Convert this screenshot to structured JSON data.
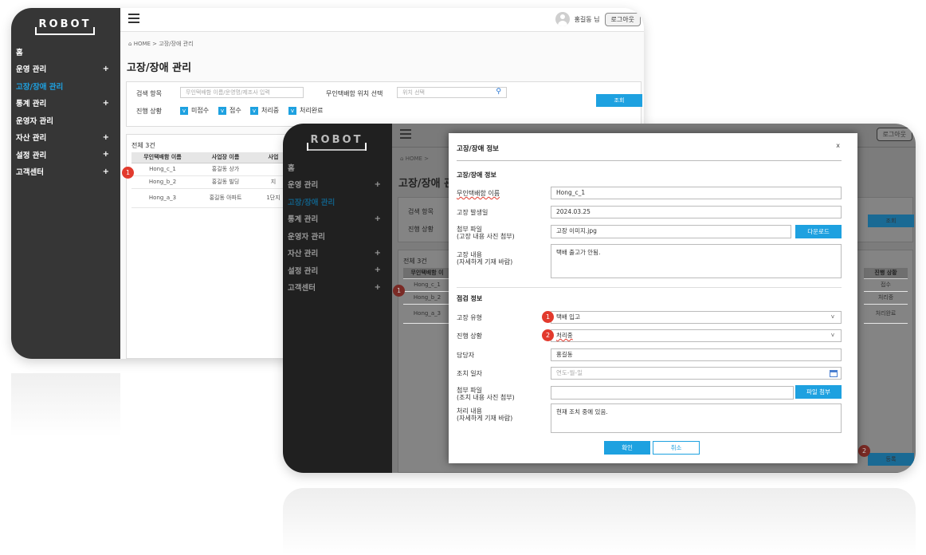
{
  "app": {
    "logo": "ROBOT",
    "user_name": "홍길동 님",
    "logout_label": "로그아웃"
  },
  "sidebar": {
    "items": [
      {
        "label": "홈",
        "plus": ""
      },
      {
        "label": "운영 관리",
        "plus": "+"
      },
      {
        "label": "고장/장애 관리",
        "plus": ""
      },
      {
        "label": "통계 관리",
        "plus": "+"
      },
      {
        "label": "운영자 관리",
        "plus": ""
      },
      {
        "label": "자산 관리",
        "plus": "+"
      },
      {
        "label": "설정 관리",
        "plus": "+"
      },
      {
        "label": "고객센터",
        "plus": "+"
      }
    ]
  },
  "breadcrumb": {
    "home": "HOME",
    "separator": ">",
    "current": "고장/장애 관리"
  },
  "page_title": "고장/장애 관리",
  "search": {
    "item_label": "검색 항목",
    "item_placeholder": "무인택배함 이름/운영명/제조사 입력",
    "location_label": "무인택배함 위치 선택",
    "location_placeholder": "위치 선택",
    "status_label": "진행 상황",
    "checks": [
      "미접수",
      "접수",
      "처리중",
      "처리완료"
    ],
    "check_mark": "v",
    "search_button": "조회"
  },
  "list": {
    "total": "전체 3건",
    "columns": [
      "무인택배함 이름",
      "사업장 이름",
      "사업"
    ],
    "rows": [
      [
        "Hong_c_1",
        "홍길동 상가",
        ""
      ],
      [
        "Hong_b_2",
        "홍길동 빌딩",
        "지"
      ],
      [
        "Hong_a_3",
        "홍길동 아파트",
        "1단지"
      ]
    ],
    "front_columns": [
      "무인택배함 이",
      "진행 상황"
    ],
    "front_rows": [
      [
        "Hong_c_1",
        "접수"
      ],
      [
        "Hong_b_2",
        "처리중"
      ],
      [
        "Hong_a_3",
        "처리완료"
      ]
    ],
    "register_button": "등록"
  },
  "badges": {
    "one": "1",
    "two": "2"
  },
  "modal": {
    "title": "고장/장애 정보",
    "close": "x",
    "section1": "고장/장애 정보",
    "name_label": "무인택배함 이름",
    "name_value": "Hong_c_1",
    "date_label": "고장 발생일",
    "date_value": "2024.03.25",
    "file_label_1": "첨부 파일",
    "file_label_2": "(고장 내용 사진 첨부)",
    "file_value": "고장 이미지.jpg",
    "download_button": "다운로드",
    "content_label_1": "고장 내용",
    "content_label_2": "(자세하게 기재 바람)",
    "content_value": "택배 출고가 안됨.",
    "section2": "점검 정보",
    "type_label": "고장 유형",
    "type_value": "택배 입고",
    "status_label": "진행 상황",
    "status_value": "처리중",
    "manager_label": "담당자",
    "manager_value": "홍길동",
    "action_date_label": "조치 일자",
    "action_date_placeholder": "연도-월-일",
    "action_file_label_1": "첨부 파일",
    "action_file_label_2": "(조치 내용 사진 첨부)",
    "attach_button": "파일 첨부",
    "action_content_label_1": "처리 내용",
    "action_content_label_2": "(자세하게 기재 바람)",
    "action_content_value": "현재 조치 중에 있음.",
    "confirm_button": "확인",
    "cancel_button": "취소",
    "chevron": "v"
  }
}
